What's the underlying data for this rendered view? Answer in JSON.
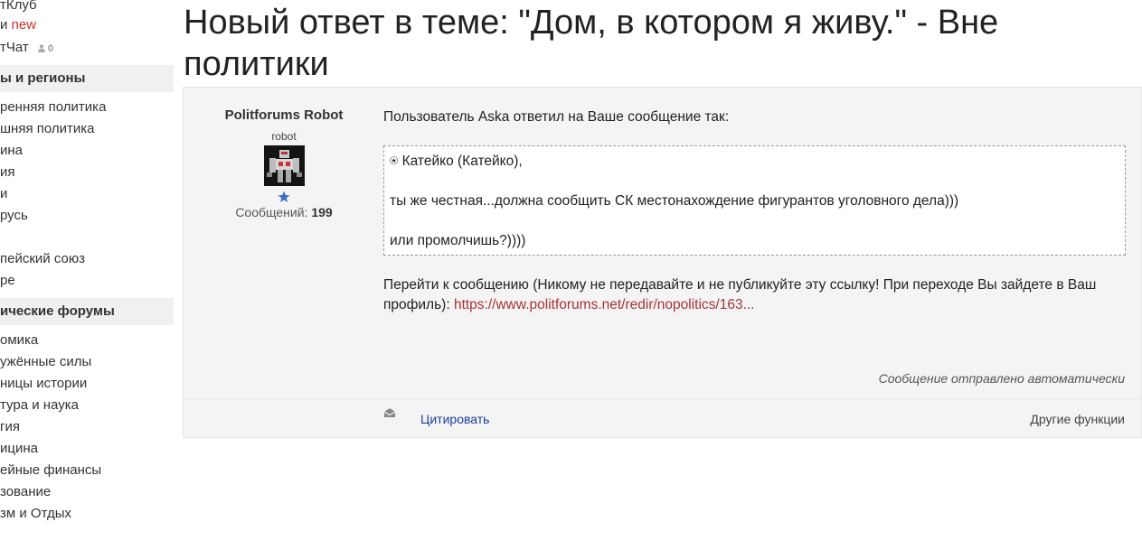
{
  "sidebar": {
    "top_links": [
      {
        "label": "тКлуб"
      },
      {
        "label": "и ",
        "extra": "new"
      },
      {
        "label": "тЧат",
        "badge": "0"
      }
    ],
    "section1_header": "ы и регионы",
    "section1_items": [
      "ренняя политика",
      "шняя политика",
      "ина",
      "ия",
      "и",
      "русь",
      "",
      "пейский союз",
      "ре"
    ],
    "section2_header": "ические форумы",
    "section2_items": [
      "омика",
      "ужённые силы",
      "ницы истории",
      "тура и наука",
      "гия",
      "ицина",
      "ейные финансы",
      "зование",
      "зм и Отдых"
    ]
  },
  "page": {
    "title": "Новый ответ в теме: \"Дом, в котором я живу.\" - Вне политики"
  },
  "post": {
    "author_name": "Politforums Robot",
    "author_role": "robot",
    "msg_count_label": "Сообщений:",
    "msg_count": "199",
    "intro": "Пользователь Aska ответил на Ваше сообщение так:",
    "quote_header": "⍟ Катейко (Катейко),",
    "quote_line1": "ты же честная...должна сообщить СК местонахождение фигурантов уголовного дела)))",
    "quote_line2": "или промолчишь?))))",
    "goto_text": "Перейти к сообщению (Никому не передавайте и не публикуйте эту ссылку! При переходе Вы зайдете в Ваш профиль): ",
    "goto_link": "https://www.politforums.net/redir/nopolitics/163...",
    "auto_sent": "Сообщение отправлено автоматически",
    "quote_button": "Цитировать",
    "other_functions": "Другие функции"
  },
  "colors": {
    "new_badge": "#d0312d",
    "link": "#a33333",
    "quote_button": "#1a3fa0",
    "panel_bg": "#f4f4f4"
  }
}
